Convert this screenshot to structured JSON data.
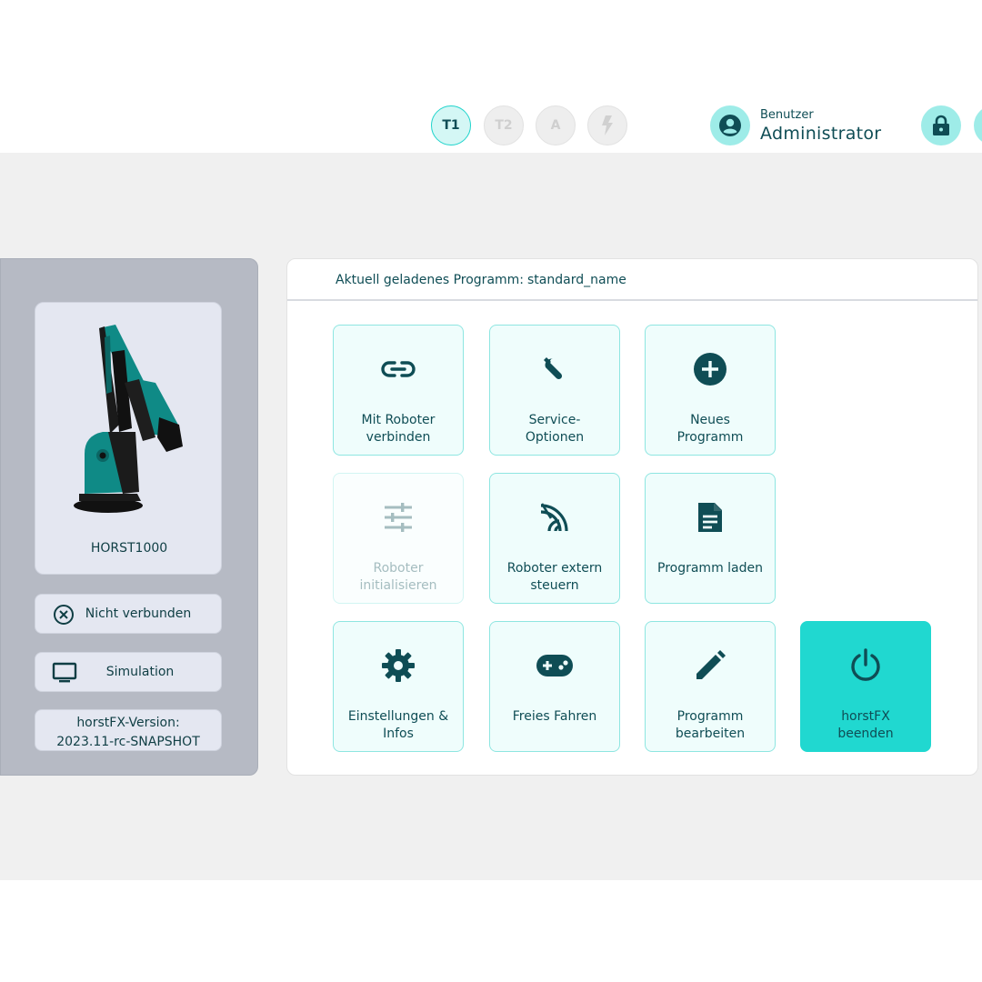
{
  "header": {
    "modes": [
      {
        "label": "T1",
        "state": "active"
      },
      {
        "label": "T2",
        "state": "inactive"
      },
      {
        "label": "A",
        "state": "inactive"
      },
      {
        "label": "",
        "icon": "lightning-icon",
        "state": "inactive"
      }
    ],
    "user": {
      "caption": "Benutzer",
      "name": "Administrator",
      "icon": "account-circle-icon"
    },
    "lock_icon": "lock-icon"
  },
  "robot": {
    "name": "HORST1000",
    "connection_status": "Nicht verbunden",
    "connection_icon": "close-circle-icon",
    "mode": "Simulation",
    "mode_icon": "monitor-icon",
    "version_line1": "horstFX-Version:",
    "version_line2": "2023.11-rc-SNAPSHOT"
  },
  "program": {
    "loaded_label": "Aktuell geladenes Programm:",
    "loaded_value": "standard_name"
  },
  "tiles": [
    {
      "label": "Mit Roboter\nverbinden",
      "icon": "link-icon",
      "state": "normal"
    },
    {
      "label": "Service-\nOptionen",
      "icon": "wrench-icon",
      "state": "normal"
    },
    {
      "label": "Neues\nProgramm",
      "icon": "plus-circle-icon",
      "state": "normal"
    },
    {
      "label": "Roboter\ninitialisieren",
      "icon": "sliders-icon",
      "state": "disabled"
    },
    {
      "label": "Roboter extern\nsteuern",
      "icon": "signal-icon",
      "state": "normal"
    },
    {
      "label": "Programm laden",
      "icon": "document-icon",
      "state": "normal"
    },
    {
      "label": "Einstellungen &\nInfos",
      "icon": "gear-icon",
      "state": "normal"
    },
    {
      "label": "Freies Fahren",
      "icon": "gamepad-icon",
      "state": "normal"
    },
    {
      "label": "Programm\nbearbeiten",
      "icon": "pencil-icon",
      "state": "normal"
    },
    {
      "label": "horstFX\nbeenden",
      "icon": "power-icon",
      "state": "primary"
    }
  ],
  "colors": {
    "accent": "#20d8d0",
    "accent_light": "#9eece8",
    "text_dark": "#0f4d55",
    "robot_teal": "#0f8a86"
  }
}
